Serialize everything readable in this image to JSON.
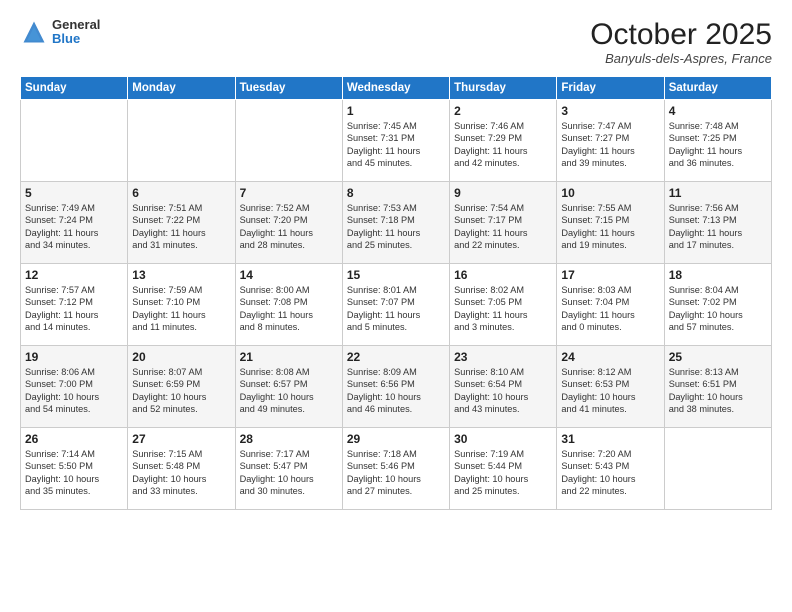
{
  "header": {
    "logo": {
      "general": "General",
      "blue": "Blue"
    },
    "title": "October 2025",
    "location": "Banyuls-dels-Aspres, France"
  },
  "days_of_week": [
    "Sunday",
    "Monday",
    "Tuesday",
    "Wednesday",
    "Thursday",
    "Friday",
    "Saturday"
  ],
  "weeks": [
    [
      {
        "day": "",
        "info": ""
      },
      {
        "day": "",
        "info": ""
      },
      {
        "day": "",
        "info": ""
      },
      {
        "day": "1",
        "info": "Sunrise: 7:45 AM\nSunset: 7:31 PM\nDaylight: 11 hours\nand 45 minutes."
      },
      {
        "day": "2",
        "info": "Sunrise: 7:46 AM\nSunset: 7:29 PM\nDaylight: 11 hours\nand 42 minutes."
      },
      {
        "day": "3",
        "info": "Sunrise: 7:47 AM\nSunset: 7:27 PM\nDaylight: 11 hours\nand 39 minutes."
      },
      {
        "day": "4",
        "info": "Sunrise: 7:48 AM\nSunset: 7:25 PM\nDaylight: 11 hours\nand 36 minutes."
      }
    ],
    [
      {
        "day": "5",
        "info": "Sunrise: 7:49 AM\nSunset: 7:24 PM\nDaylight: 11 hours\nand 34 minutes."
      },
      {
        "day": "6",
        "info": "Sunrise: 7:51 AM\nSunset: 7:22 PM\nDaylight: 11 hours\nand 31 minutes."
      },
      {
        "day": "7",
        "info": "Sunrise: 7:52 AM\nSunset: 7:20 PM\nDaylight: 11 hours\nand 28 minutes."
      },
      {
        "day": "8",
        "info": "Sunrise: 7:53 AM\nSunset: 7:18 PM\nDaylight: 11 hours\nand 25 minutes."
      },
      {
        "day": "9",
        "info": "Sunrise: 7:54 AM\nSunset: 7:17 PM\nDaylight: 11 hours\nand 22 minutes."
      },
      {
        "day": "10",
        "info": "Sunrise: 7:55 AM\nSunset: 7:15 PM\nDaylight: 11 hours\nand 19 minutes."
      },
      {
        "day": "11",
        "info": "Sunrise: 7:56 AM\nSunset: 7:13 PM\nDaylight: 11 hours\nand 17 minutes."
      }
    ],
    [
      {
        "day": "12",
        "info": "Sunrise: 7:57 AM\nSunset: 7:12 PM\nDaylight: 11 hours\nand 14 minutes."
      },
      {
        "day": "13",
        "info": "Sunrise: 7:59 AM\nSunset: 7:10 PM\nDaylight: 11 hours\nand 11 minutes."
      },
      {
        "day": "14",
        "info": "Sunrise: 8:00 AM\nSunset: 7:08 PM\nDaylight: 11 hours\nand 8 minutes."
      },
      {
        "day": "15",
        "info": "Sunrise: 8:01 AM\nSunset: 7:07 PM\nDaylight: 11 hours\nand 5 minutes."
      },
      {
        "day": "16",
        "info": "Sunrise: 8:02 AM\nSunset: 7:05 PM\nDaylight: 11 hours\nand 3 minutes."
      },
      {
        "day": "17",
        "info": "Sunrise: 8:03 AM\nSunset: 7:04 PM\nDaylight: 11 hours\nand 0 minutes."
      },
      {
        "day": "18",
        "info": "Sunrise: 8:04 AM\nSunset: 7:02 PM\nDaylight: 10 hours\nand 57 minutes."
      }
    ],
    [
      {
        "day": "19",
        "info": "Sunrise: 8:06 AM\nSunset: 7:00 PM\nDaylight: 10 hours\nand 54 minutes."
      },
      {
        "day": "20",
        "info": "Sunrise: 8:07 AM\nSunset: 6:59 PM\nDaylight: 10 hours\nand 52 minutes."
      },
      {
        "day": "21",
        "info": "Sunrise: 8:08 AM\nSunset: 6:57 PM\nDaylight: 10 hours\nand 49 minutes."
      },
      {
        "day": "22",
        "info": "Sunrise: 8:09 AM\nSunset: 6:56 PM\nDaylight: 10 hours\nand 46 minutes."
      },
      {
        "day": "23",
        "info": "Sunrise: 8:10 AM\nSunset: 6:54 PM\nDaylight: 10 hours\nand 43 minutes."
      },
      {
        "day": "24",
        "info": "Sunrise: 8:12 AM\nSunset: 6:53 PM\nDaylight: 10 hours\nand 41 minutes."
      },
      {
        "day": "25",
        "info": "Sunrise: 8:13 AM\nSunset: 6:51 PM\nDaylight: 10 hours\nand 38 minutes."
      }
    ],
    [
      {
        "day": "26",
        "info": "Sunrise: 7:14 AM\nSunset: 5:50 PM\nDaylight: 10 hours\nand 35 minutes."
      },
      {
        "day": "27",
        "info": "Sunrise: 7:15 AM\nSunset: 5:48 PM\nDaylight: 10 hours\nand 33 minutes."
      },
      {
        "day": "28",
        "info": "Sunrise: 7:17 AM\nSunset: 5:47 PM\nDaylight: 10 hours\nand 30 minutes."
      },
      {
        "day": "29",
        "info": "Sunrise: 7:18 AM\nSunset: 5:46 PM\nDaylight: 10 hours\nand 27 minutes."
      },
      {
        "day": "30",
        "info": "Sunrise: 7:19 AM\nSunset: 5:44 PM\nDaylight: 10 hours\nand 25 minutes."
      },
      {
        "day": "31",
        "info": "Sunrise: 7:20 AM\nSunset: 5:43 PM\nDaylight: 10 hours\nand 22 minutes."
      },
      {
        "day": "",
        "info": ""
      }
    ]
  ]
}
